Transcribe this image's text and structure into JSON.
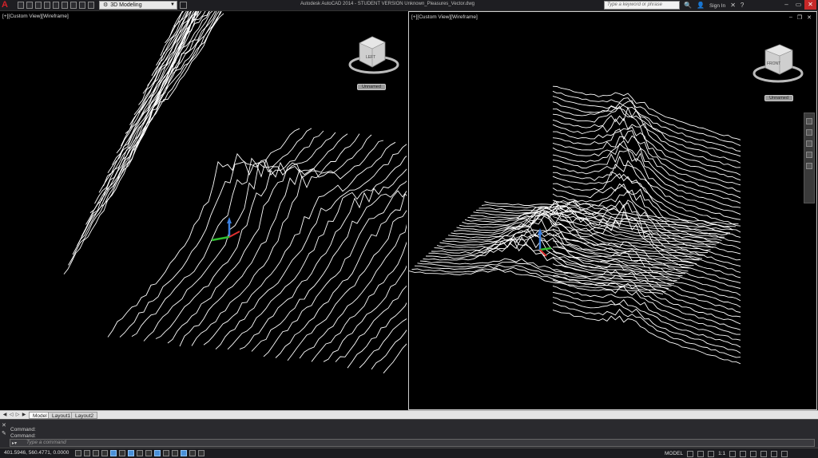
{
  "app": {
    "title": "Autodesk AutoCAD 2014 - STUDENT VERSION   Unknown_Pleasures_Vector.dwg",
    "logo_letter": "A"
  },
  "toolbar": {
    "workspace": "3D Modeling",
    "search_placeholder": "Type a keyword or phrase",
    "sign_in": "Sign In",
    "help": "?"
  },
  "viewports": {
    "left": {
      "label": "[+][Custom View][Wireframe]",
      "cube_face_label": "LEFT",
      "wcs_label": "Unnamed"
    },
    "right": {
      "label": "[+][Custom View][Wireframe]",
      "cube_face_label": "FRONT",
      "wcs_label": "Unnamed"
    }
  },
  "layout_tabs": [
    "Model",
    "Layout1",
    "Layout2"
  ],
  "command": {
    "history": [
      "Command:",
      "Command:"
    ],
    "placeholder": "Type a command"
  },
  "status": {
    "coordinates": "401.5946, 560.4771, 0.0000",
    "space": "MODEL",
    "scale": "1:1"
  },
  "colors": {
    "background": "#000000",
    "wireframe": "#ffffff",
    "axis_x": "#e03030",
    "axis_y": "#30c030",
    "axis_z": "#3a7fe0",
    "brand": "#d3222a"
  }
}
